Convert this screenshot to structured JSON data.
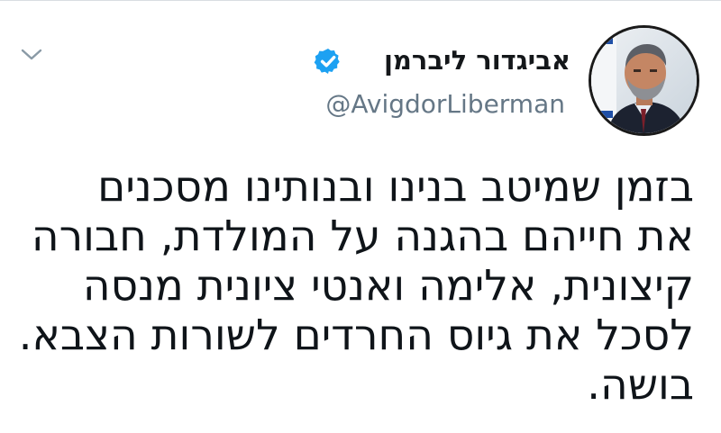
{
  "tweet": {
    "author": {
      "display_name": "אביגדור ליברמן",
      "handle": "@AvigdorLiberman",
      "verified": true,
      "verified_icon": "verified-badge-icon"
    },
    "menu_icon": "chevron-down-icon",
    "lines": [
      "בזמן שמיטב בנינו ובנותינו מסכנים",
      "את חייהם בהגנה על המולדת, חבורה",
      "קיצונית, אלימה ואנטי ציונית מנסה",
      "לסכל את גיוס החרדים לשורות הצבא.",
      "בושה."
    ]
  },
  "colors": {
    "verified_blue": "#1da1f2",
    "handle_gray": "#657786",
    "text": "#0f1419"
  }
}
